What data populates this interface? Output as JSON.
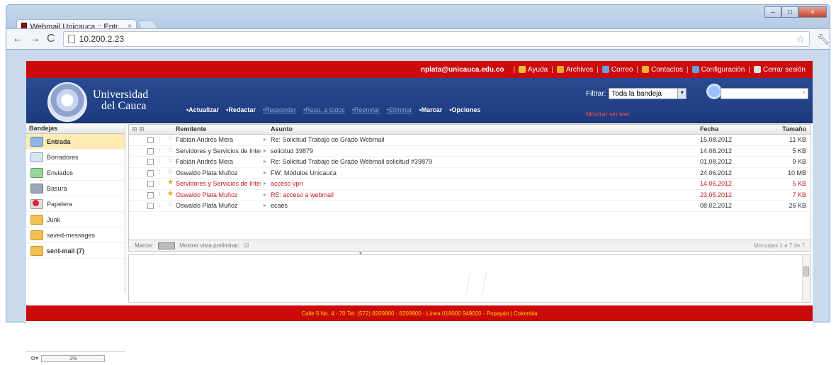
{
  "browser": {
    "tab_title": "Webmail Unicauca :: Entr...",
    "address": "10.200.2.23"
  },
  "topbar": {
    "user_email": "nplata@unicauca.edu.co",
    "links": [
      {
        "label": "Ayuda",
        "icon": "help-icon",
        "color": "#e8c23a"
      },
      {
        "label": "Archivos",
        "icon": "files-icon",
        "color": "#f0a830"
      },
      {
        "label": "Correo",
        "icon": "mail-icon",
        "color": "#6aa0e0"
      },
      {
        "label": "Contactos",
        "icon": "contacts-icon",
        "color": "#f0b030"
      },
      {
        "label": "Configuración",
        "icon": "settings-icon",
        "color": "#6aa0e0"
      },
      {
        "label": "Cerrar sesión",
        "icon": "logout-icon",
        "color": "#e0e0e0"
      }
    ]
  },
  "header": {
    "uni_line1": "Universidad",
    "uni_line2": "del Cauca",
    "nav": [
      {
        "label": "•Actualizar",
        "style": "active"
      },
      {
        "label": "•Redactar",
        "style": "active"
      },
      {
        "label": "•Responder",
        "style": "dim"
      },
      {
        "label": "•Resp. a todos",
        "style": "dim"
      },
      {
        "label": "•Reenviar",
        "style": "dim"
      },
      {
        "label": "•Eliminar",
        "style": "dim"
      },
      {
        "label": "•Marcar",
        "style": "active"
      },
      {
        "label": "•Opciones",
        "style": "active"
      }
    ],
    "filter_label": "Filtrar:",
    "filter_value": "Toda la bandeja",
    "unread_filter": "Mostrar sin leer"
  },
  "folders": {
    "title": "Bandejas",
    "items": [
      {
        "label": "Entrada",
        "icon": "inbox-folder-icon",
        "cls": "inbox",
        "selected": true
      },
      {
        "label": "Borradores",
        "icon": "drafts-folder-icon",
        "cls": "drafts"
      },
      {
        "label": "Enviados",
        "icon": "sent-folder-icon",
        "cls": "sent"
      },
      {
        "label": "Basura",
        "icon": "trash-folder-icon",
        "cls": "trash"
      },
      {
        "label": "Papelera",
        "icon": "bin-folder-icon",
        "cls": "paper"
      },
      {
        "label": "Junk",
        "icon": "junk-folder-icon",
        "cls": "junk"
      },
      {
        "label": "saved-messages",
        "icon": "folder-icon",
        "cls": "junk"
      },
      {
        "label": "sent-mail (7)",
        "icon": "folder-icon",
        "cls": "junk",
        "bold": true
      }
    ],
    "quota": "1%"
  },
  "messages": {
    "headers": {
      "sender": "Remitente",
      "subject": "Asunto",
      "date": "Fecha",
      "size": "Tamaño"
    },
    "rows": [
      {
        "from": "Fabián Andrés Mera",
        "subject": "Re: Solicitud Trabajo de Grado Webmail",
        "date": "15.08.2012",
        "size": "11 KB",
        "unread": false
      },
      {
        "from": "Servidores y Servicios de Inter",
        "subject": "solicitud 39879",
        "date": "14.08.2012",
        "size": "5 KB",
        "unread": false
      },
      {
        "from": "Fabián Andrés Mera",
        "subject": "Re: Solicitud Trabajo de Grado Webmail solicitud #39879",
        "date": "01.08.2012",
        "size": "9 KB",
        "unread": false
      },
      {
        "from": "Oswaldo Plata Muñoz",
        "subject": "FW: Módulos Unicauca",
        "date": "24.06.2012",
        "size": "10 MB",
        "unread": false
      },
      {
        "from": "Servidores y Servicios de Inter",
        "subject": "acceso vpn",
        "date": "14.06.2012",
        "size": "5 KB",
        "unread": true
      },
      {
        "from": "Oswaldo Plata Muñoz",
        "subject": "RE: acceso a webmail",
        "date": "23.05.2012",
        "size": "7 KB",
        "unread": true
      },
      {
        "from": "Oswaldo Plata Muñoz",
        "subject": "ecaes",
        "date": "08.02.2012",
        "size": "26 KB",
        "unread": false
      }
    ],
    "footer_left": "Marcar:",
    "footer_preview": "Mostrar vista preliminar:",
    "pager": "Mensajes 1 a 7 de 7"
  },
  "footer": {
    "text": "Calle 5 No. 4 - 70 Tel: (572) 8209800 - 8209900 - Línea 018000 949020 - Popayán | Colombia"
  }
}
